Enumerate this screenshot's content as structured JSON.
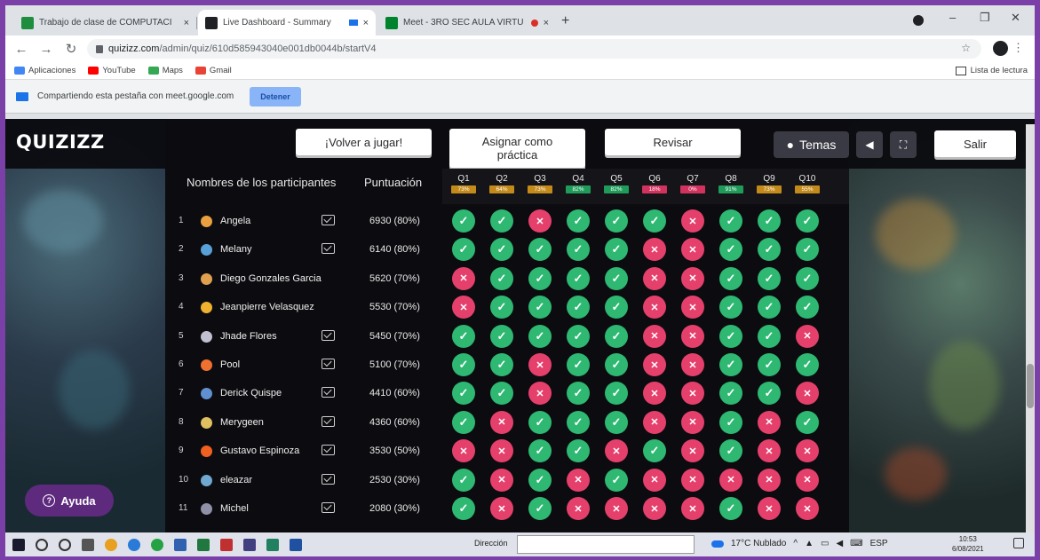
{
  "browser": {
    "tabs": [
      {
        "label": "Trabajo de clase de COMPUTACI",
        "favicon_color": "#1e8e3e",
        "active": false
      },
      {
        "label": "Live Dashboard - Summary",
        "favicon_color": "#202124",
        "active": true
      },
      {
        "label": "Meet - 3RO SEC AULA VIRTU",
        "favicon_color": "#00832d",
        "active": false
      }
    ],
    "tab_close": "×",
    "new_tab": "+",
    "url_host": "quizizz.com",
    "url_path": "/admin/quiz/610d585943040e001db0044b/startV4",
    "bookmarks": [
      {
        "label": "Aplicaciones",
        "color": "#4285f4"
      },
      {
        "label": "YouTube",
        "color": "#ff0000"
      },
      {
        "label": "Maps",
        "color": "#34a853"
      },
      {
        "label": "Gmail",
        "color": "#ea4335"
      }
    ],
    "reading_list": "Lista de lectura",
    "share_text": "Compartiendo esta pestaña con meet.google.com",
    "stop_label": "Detener"
  },
  "header": {
    "logo": "QUIZIZZ",
    "play_again": "¡Volver a jugar!",
    "assign": "Asignar como práctica",
    "review": "Revisar",
    "themes": "Temas",
    "exit": "Salir"
  },
  "table": {
    "participants_header": "Nombres de los participantes",
    "score_header": "Puntuación",
    "questions": [
      {
        "label": "Q1",
        "pct": "73%",
        "color": "#c48a1a"
      },
      {
        "label": "Q2",
        "pct": "64%",
        "color": "#c48a1a"
      },
      {
        "label": "Q3",
        "pct": "73%",
        "color": "#c48a1a"
      },
      {
        "label": "Q4",
        "pct": "82%",
        "color": "#1f9b5a"
      },
      {
        "label": "Q5",
        "pct": "82%",
        "color": "#1f9b5a"
      },
      {
        "label": "Q6",
        "pct": "18%",
        "color": "#d1335e"
      },
      {
        "label": "Q7",
        "pct": "0%",
        "color": "#d1335e"
      },
      {
        "label": "Q8",
        "pct": "91%",
        "color": "#1f9b5a"
      },
      {
        "label": "Q9",
        "pct": "73%",
        "color": "#c48a1a"
      },
      {
        "label": "Q10",
        "pct": "55%",
        "color": "#c48a1a"
      }
    ],
    "rows": [
      {
        "rank": "1",
        "name": "Angela",
        "score": "6930 (80%)",
        "mail": true,
        "avatar": "#e8a040",
        "answers": [
          1,
          1,
          0,
          1,
          1,
          1,
          0,
          1,
          1,
          1
        ]
      },
      {
        "rank": "2",
        "name": "Melany",
        "score": "6140 (80%)",
        "mail": true,
        "avatar": "#5aa0d8",
        "answers": [
          1,
          1,
          1,
          1,
          1,
          0,
          0,
          1,
          1,
          1
        ]
      },
      {
        "rank": "3",
        "name": "Diego Gonzales Garcia",
        "score": "5620 (70%)",
        "mail": false,
        "avatar": "#e0a050",
        "answers": [
          0,
          1,
          1,
          1,
          1,
          0,
          0,
          1,
          1,
          1
        ]
      },
      {
        "rank": "4",
        "name": "Jeanpierre Velasquez",
        "score": "5530 (70%)",
        "mail": false,
        "avatar": "#f0b030",
        "answers": [
          0,
          1,
          1,
          1,
          1,
          0,
          0,
          1,
          1,
          1
        ]
      },
      {
        "rank": "5",
        "name": "Jhade Flores",
        "score": "5450 (70%)",
        "mail": true,
        "avatar": "#c0c0d0",
        "answers": [
          1,
          1,
          1,
          1,
          1,
          0,
          0,
          1,
          1,
          0
        ]
      },
      {
        "rank": "6",
        "name": "Pool",
        "score": "5100 (70%)",
        "mail": true,
        "avatar": "#f07030",
        "answers": [
          1,
          1,
          0,
          1,
          1,
          0,
          0,
          1,
          1,
          1
        ]
      },
      {
        "rank": "7",
        "name": "Derick Quispe",
        "score": "4410 (60%)",
        "mail": true,
        "avatar": "#6090d0",
        "answers": [
          1,
          1,
          0,
          1,
          1,
          0,
          0,
          1,
          1,
          0
        ]
      },
      {
        "rank": "8",
        "name": "Merygeen",
        "score": "4360 (60%)",
        "mail": true,
        "avatar": "#e0c060",
        "answers": [
          1,
          0,
          1,
          1,
          1,
          0,
          0,
          1,
          0,
          1
        ]
      },
      {
        "rank": "9",
        "name": "Gustavo Espinoza",
        "score": "3530 (50%)",
        "mail": true,
        "avatar": "#f06020",
        "answers": [
          0,
          0,
          1,
          1,
          0,
          1,
          0,
          1,
          0,
          0
        ]
      },
      {
        "rank": "10",
        "name": "eleazar",
        "score": "2530 (30%)",
        "mail": true,
        "avatar": "#70a8d0",
        "answers": [
          1,
          0,
          1,
          0,
          1,
          0,
          0,
          0,
          0,
          0
        ]
      },
      {
        "rank": "11",
        "name": "Michel",
        "score": "2080 (30%)",
        "mail": true,
        "avatar": "#9090a8",
        "answers": [
          1,
          0,
          1,
          0,
          0,
          0,
          0,
          1,
          0,
          0
        ]
      }
    ]
  },
  "help": "Ayuda",
  "taskbar": {
    "address_label": "Dirección",
    "weather": "17°C Nublado",
    "lang": "ESP",
    "time": "10:53",
    "date": "6/08/2021"
  }
}
